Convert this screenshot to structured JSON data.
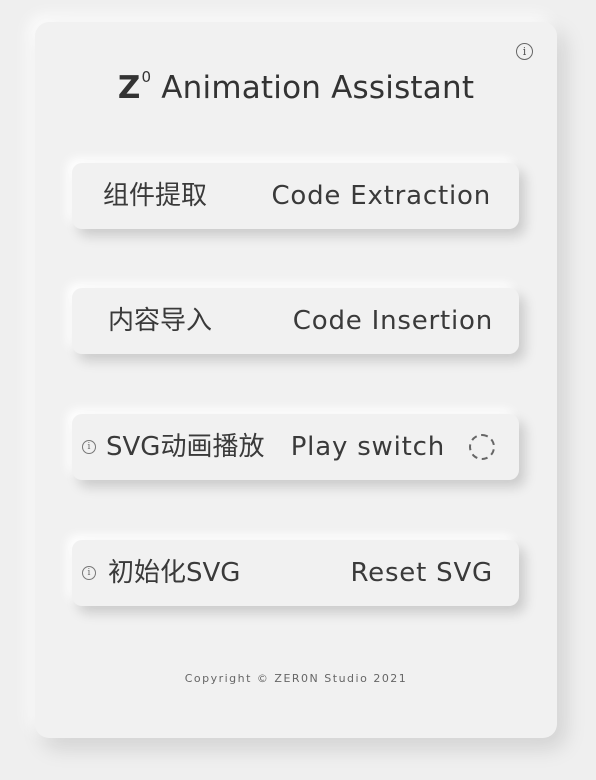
{
  "app": {
    "title_logo": "Z",
    "title_superscript": "0",
    "title_text": "Animation Assistant",
    "info_glyph": "i"
  },
  "buttons": [
    {
      "zh": "组件提取",
      "en": "Code Extraction"
    },
    {
      "zh": "内容导入",
      "en": "Code Insertion"
    },
    {
      "zh": "SVG动画播放",
      "en": "Play switch"
    },
    {
      "zh": "初始化SVG",
      "en": "Reset SVG"
    }
  ],
  "footer": {
    "copyright": "Copyright © ZER0N Studio 2021"
  },
  "icons": [
    "info-icon",
    "toggle-spinner-icon"
  ],
  "colors": {
    "background": "#efefef",
    "panel": "#f1f1f1",
    "text": "#3a3a3a"
  }
}
